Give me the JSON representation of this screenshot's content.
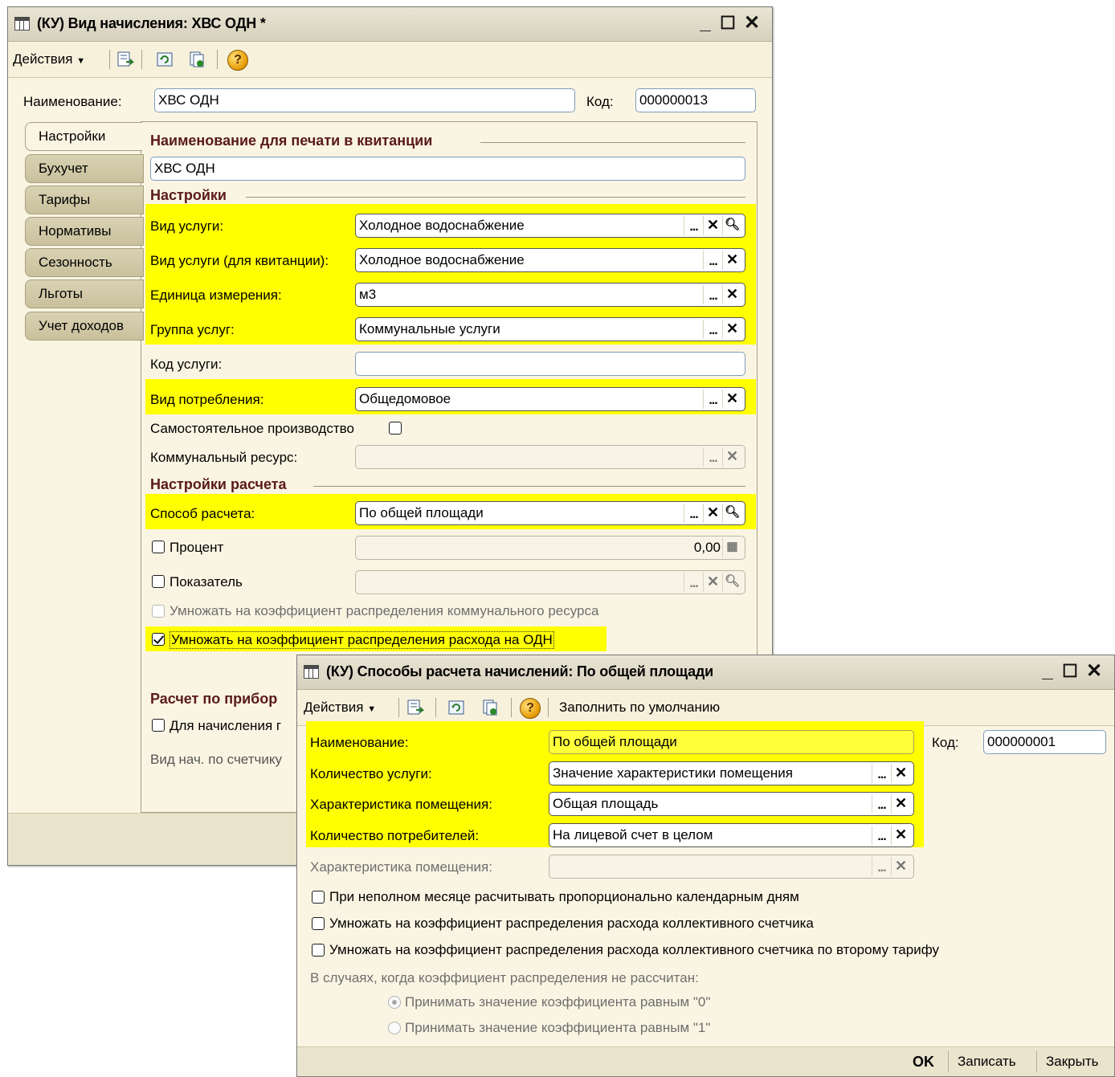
{
  "win1": {
    "title": "(КУ) Вид начисления: ХВС ОДН *",
    "toolbar": {
      "actions_label": "Действия"
    },
    "name_label": "Наименование:",
    "name_value": "ХВС ОДН",
    "code_label": "Код:",
    "code_value": "000000013",
    "tabs": [
      "Настройки",
      "Бухучет",
      "Тарифы",
      "Нормативы",
      "Сезонность",
      "Льготы",
      "Учет доходов"
    ],
    "print_name_section": "Наименование для печати в квитанции",
    "print_name_value": "ХВС ОДН",
    "settings_section": "Настройки",
    "fields": {
      "service_type_label": "Вид услуги:",
      "service_type_value": "Холодное водоснабжение",
      "service_type_receipt_label": "Вид услуги (для квитанции):",
      "service_type_receipt_value": "Холодное водоснабжение",
      "unit_label": "Единица измерения:",
      "unit_value": "м3",
      "service_group_label": "Группа услуг:",
      "service_group_value": "Коммунальные услуги",
      "service_code_label": "Код услуги:",
      "service_code_value": "",
      "consumption_type_label": "Вид потребления:",
      "consumption_type_value": "Общедомовое",
      "self_production_label": "Самостоятельное производство",
      "utility_resource_label": "Коммунальный ресурс:",
      "utility_resource_value": ""
    },
    "calc_section": "Настройки расчета",
    "calc": {
      "method_label": "Способ расчета:",
      "method_value": "По общей площади",
      "percent_label": "Процент",
      "percent_value": "0,00",
      "indicator_label": "Показатель",
      "indicator_value": "",
      "multiply_resource_label": "Умножать на коэффициент распределения коммунального ресурса",
      "multiply_odn_label": "Умножать на коэффициент распределения расхода на ОДН"
    },
    "meter_section": "Расчет по прибор",
    "meter_checkbox_label": "Для начисления г",
    "meter_kind_label": "Вид нач. по счетчику"
  },
  "win2": {
    "title": "(КУ) Способы расчета начислений: По общей площади",
    "toolbar": {
      "actions_label": "Действия",
      "fill_default_label": "Заполнить по умолчанию"
    },
    "name_label": "Наименование:",
    "name_value": "По общей площади",
    "code_label": "Код:",
    "code_value": "000000001",
    "service_qty_label": "Количество услуги:",
    "service_qty_value": "Значение характеристики помещения",
    "room_char_label": "Характеристика помещения:",
    "room_char_value": "Общая площадь",
    "consumers_qty_label": "Количество потребителей:",
    "consumers_qty_value": "На лицевой счет в целом",
    "room_char2_label": "Характеристика помещения:",
    "room_char2_value": "",
    "cb_partial_month": "При неполном месяце расчитывать пропорционально календарным дням",
    "cb_collective": "Умножать на коэффициент распределения расхода коллективного счетчика",
    "cb_collective_second": "Умножать на коэффициент распределения расхода коллективного счетчика по второму тарифу",
    "coef_note": "В случаях, когда коэффициент распределения не рассчитан:",
    "radio_zero": "Принимать значение коэффициента равным \"0\"",
    "radio_one": "Принимать значение коэффициента равным \"1\"",
    "ok_label": "OK",
    "save_label": "Записать",
    "close_label": "Закрыть"
  },
  "colors": {
    "highlight": "#ffff00",
    "window_bg": "#faf5e3",
    "section_text": "#5a1a1a"
  }
}
